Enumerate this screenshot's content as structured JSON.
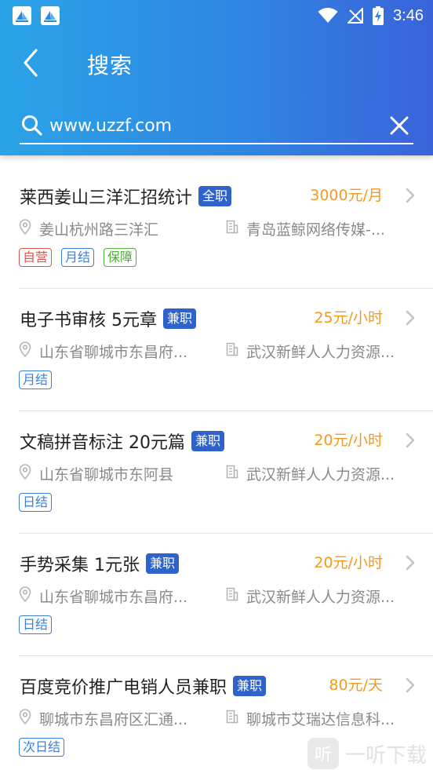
{
  "status_bar": {
    "time": "3:46"
  },
  "header": {
    "title": "搜索"
  },
  "search": {
    "value": "www.uzzf.com",
    "placeholder": ""
  },
  "jobs": [
    {
      "title": "莱西姜山三洋汇招统计",
      "type": "全职",
      "salary": "3000元/月",
      "location": "姜山杭州路三洋汇",
      "company": "青岛蓝鲸网络传媒-...",
      "tags": [
        {
          "label": "自营",
          "color": "red"
        },
        {
          "label": "月结",
          "color": "blue"
        },
        {
          "label": "保障",
          "color": "green"
        }
      ]
    },
    {
      "title": "电子书审核 5元章",
      "type": "兼职",
      "salary": "25元/小时",
      "location": "山东省聊城市东昌府...",
      "company": "武汉新鲜人人力资源...",
      "tags": [
        {
          "label": "月结",
          "color": "blue"
        }
      ]
    },
    {
      "title": "文稿拼音标注 20元篇",
      "type": "兼职",
      "salary": "20元/小时",
      "location": "山东省聊城市东阿县",
      "company": "武汉新鲜人人力资源...",
      "tags": [
        {
          "label": "日结",
          "color": "blue"
        }
      ]
    },
    {
      "title": "手势采集 1元张",
      "type": "兼职",
      "salary": "20元/小时",
      "location": "山东省聊城市东昌府...",
      "company": "武汉新鲜人人力资源...",
      "tags": [
        {
          "label": "日结",
          "color": "blue"
        }
      ]
    },
    {
      "title": "百度竞价推广电销人员兼职",
      "type": "兼职",
      "salary": "80元/天",
      "location": "聊城市东昌府区汇通...",
      "company": "聊城市艾瑞达信息科...",
      "tags": [
        {
          "label": "次日结",
          "color": "blue"
        }
      ]
    }
  ],
  "watermark": {
    "logo_char": "听",
    "text": "一听下载"
  },
  "colors": {
    "header_start": "#2aa3e6",
    "header_end": "#3a63da",
    "salary": "#f29a1c",
    "badge": "#2f63c9",
    "tag_red": "#e05454",
    "tag_blue": "#3b80d6",
    "tag_green": "#4eae3a"
  }
}
